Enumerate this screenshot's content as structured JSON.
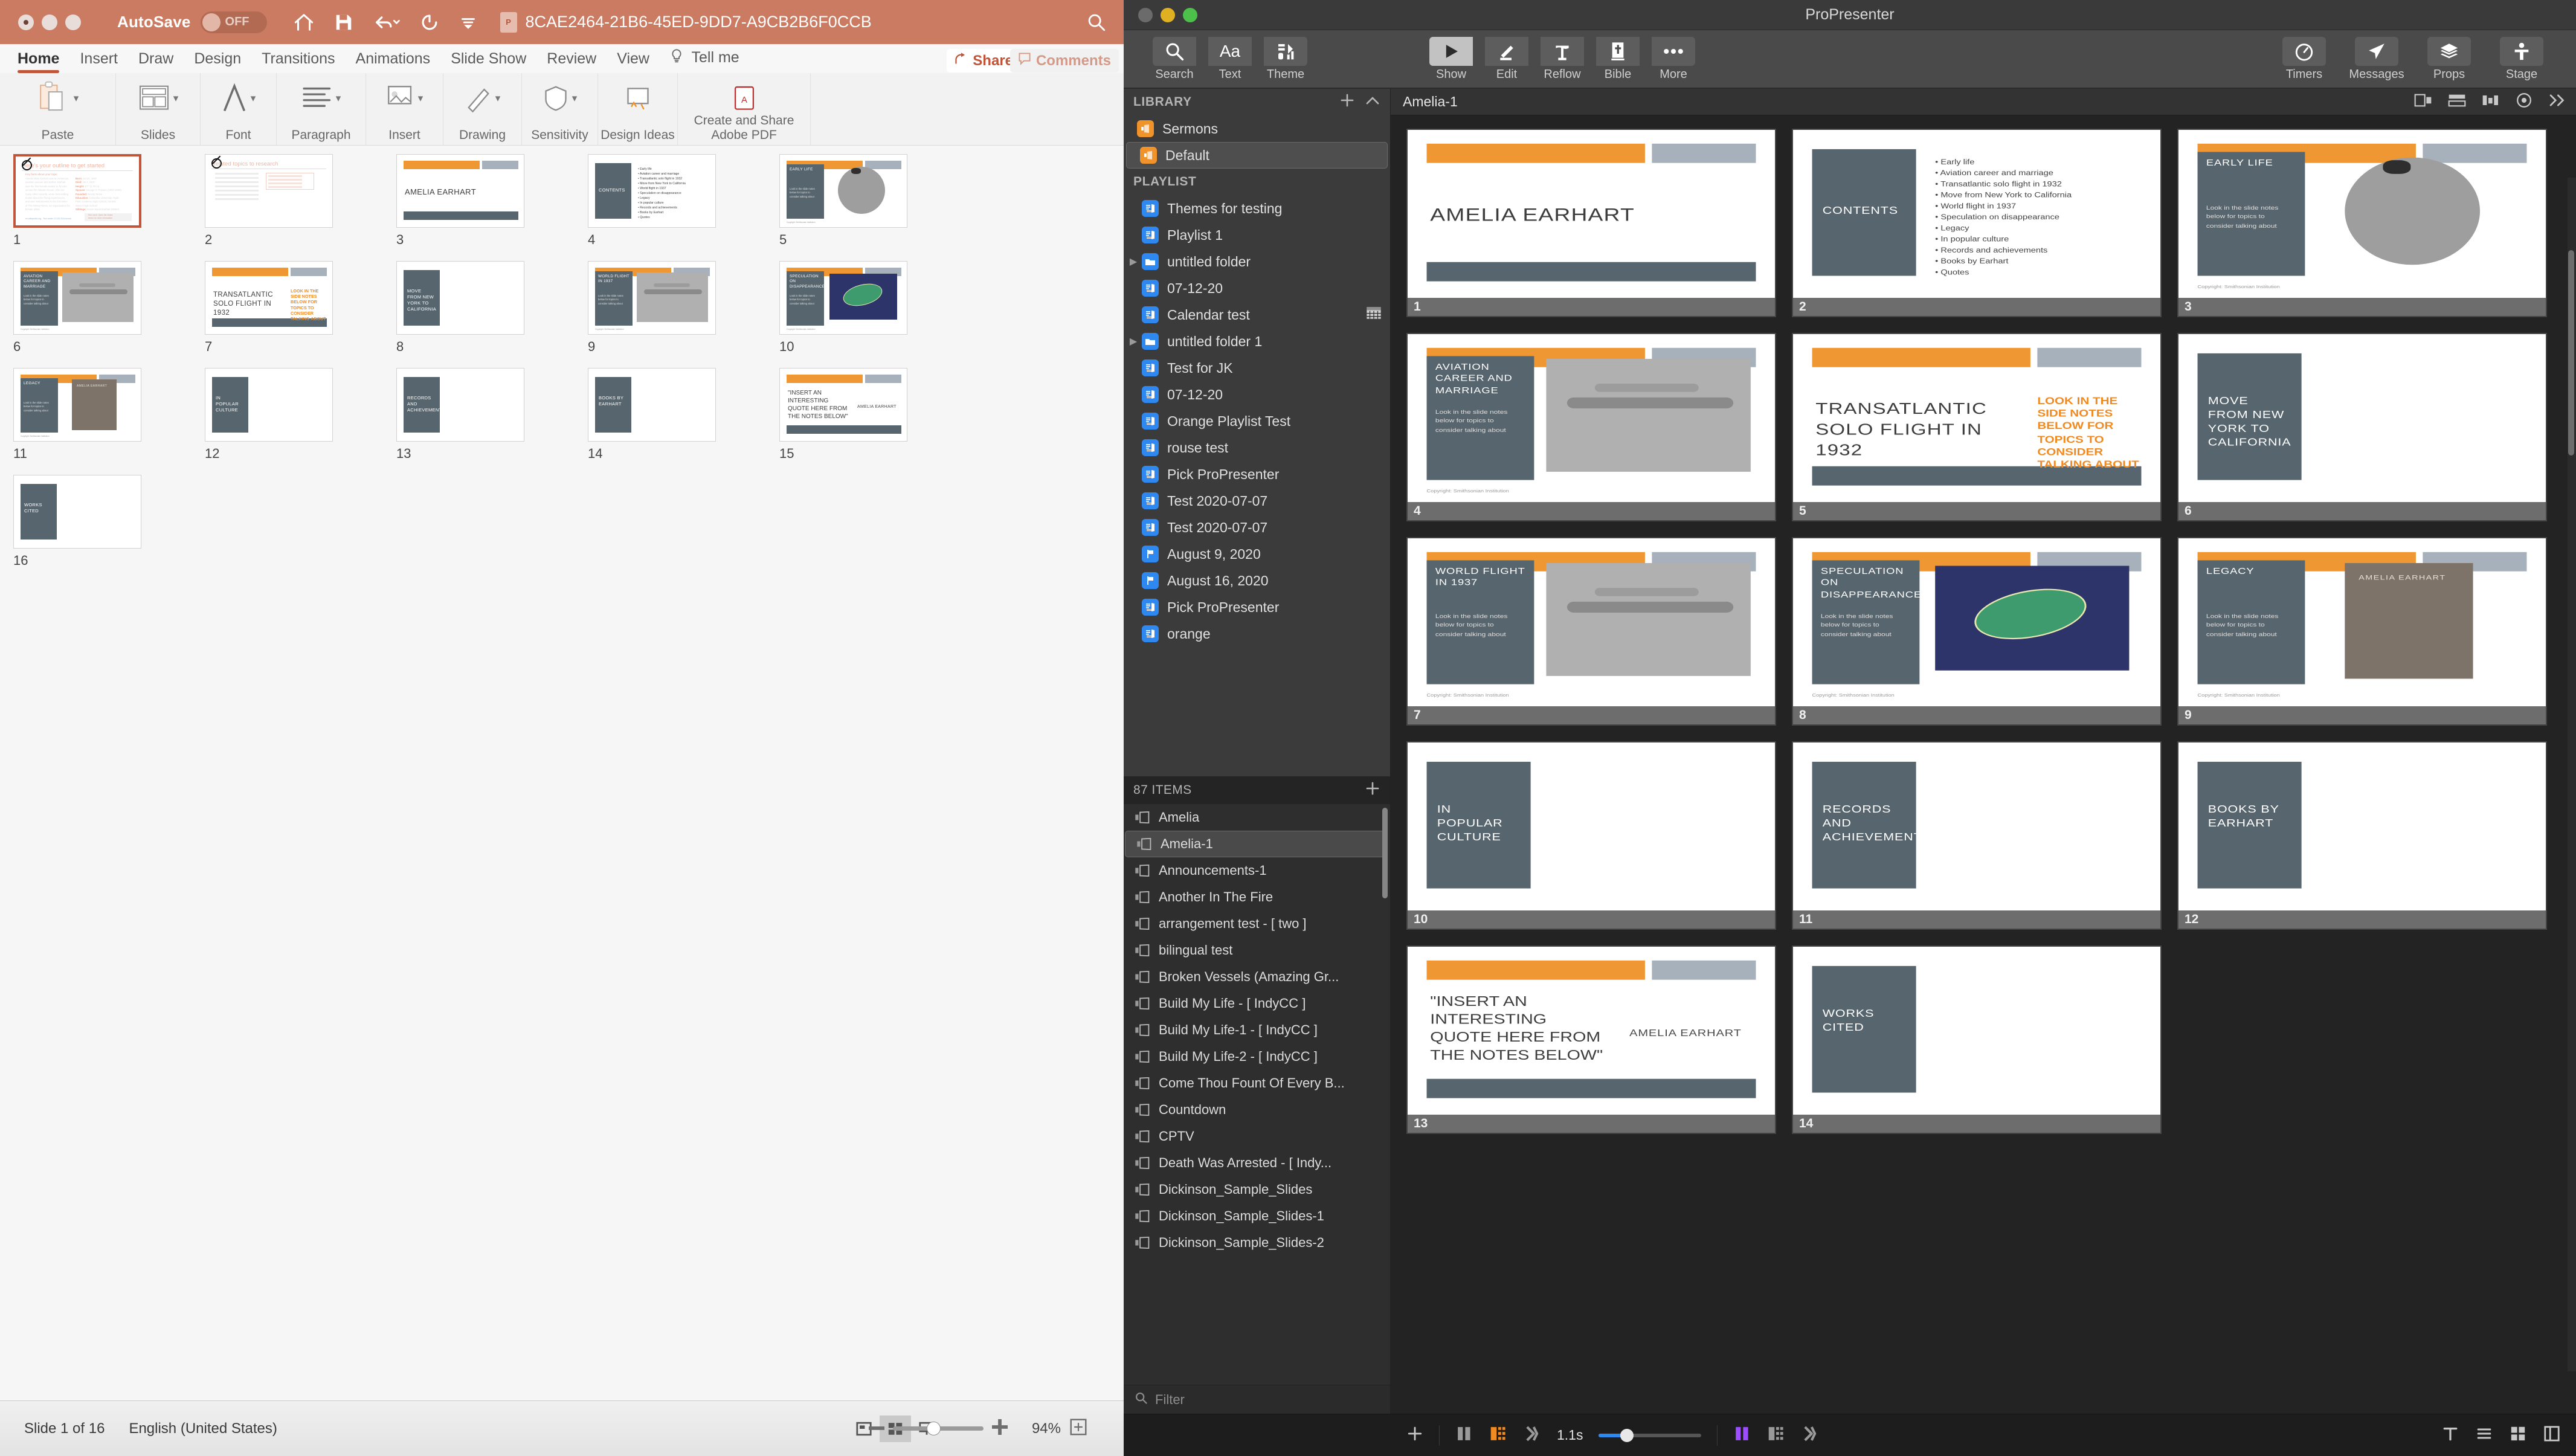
{
  "powerpoint": {
    "titlebar": {
      "autosave_label": "AutoSave",
      "autosave_state": "OFF",
      "filename": "8CAE2464-21B6-45ED-9DD7-A9CB2B6F0CCB",
      "quick_icons": [
        "home-icon",
        "save-icon",
        "undo-icon",
        "redo-icon",
        "customize-toolbar-icon"
      ],
      "search_icon": "search-icon"
    },
    "tabs": [
      {
        "label": "Home",
        "active": true
      },
      {
        "label": "Insert",
        "active": false
      },
      {
        "label": "Draw",
        "active": false
      },
      {
        "label": "Design",
        "active": false
      },
      {
        "label": "Transitions",
        "active": false
      },
      {
        "label": "Animations",
        "active": false
      },
      {
        "label": "Slide Show",
        "active": false
      },
      {
        "label": "Review",
        "active": false
      },
      {
        "label": "View",
        "active": false
      },
      {
        "label": "Tell me",
        "active": false
      }
    ],
    "share_label": "Share",
    "comments_label": "Comments",
    "ribbon_groups": [
      {
        "label": "Paste"
      },
      {
        "label": "Slides"
      },
      {
        "label": "Font"
      },
      {
        "label": "Paragraph"
      },
      {
        "label": "Insert"
      },
      {
        "label": "Drawing"
      },
      {
        "label": "Sensitivity"
      },
      {
        "label": "Design Ideas"
      },
      {
        "label": "Create and Share Adobe PDF"
      }
    ],
    "status": {
      "slide_counter": "Slide 1 of 16",
      "language": "English (United States)",
      "zoom_percent": "94%"
    },
    "slides": [
      {
        "num": "1",
        "type": "outline",
        "title": "Here's your outline to get started",
        "subtitle": "Key facts about your topic",
        "body": "Amelia Mary Earhart was an American aviation pioneer and author. Earhart was the first female aviator to fly solo across the Atlantic Ocean. She set many other records, wrote best-selling books about her flying experiences, and was instrumental in the formation of The Ninety-Nines, an organization for female pilots.",
        "facts": [
          "Born: Jul 24, 1897",
          "Died: Jul 2, 1937",
          "Height: 5'7\" (1.70 m)",
          "Spouse: George P. Putnam (1931-1939)",
          "Founded: Ninety-Nines",
          "Education: Columbia University, Hyde Park Academy High School, Central Senior High School",
          "Siblings: Grace Muriel Earhart (Sister)"
        ],
        "source": "en.wikipedia.org - Text under CC-BY-SA license",
        "seemore": "See more: Open the Notes below for more information."
      },
      {
        "num": "2",
        "type": "outline2",
        "title": "Related topics to research"
      },
      {
        "num": "3",
        "type": "title",
        "title": "AMELIA EARHART"
      },
      {
        "num": "4",
        "type": "contents",
        "label": "CONTENTS",
        "bullets": [
          "Early life",
          "Aviation career and marriage",
          "Transatlantic solo flight in 1932",
          "Move from New York to California",
          "World flight in 1937",
          "Speculation on disappearance",
          "Legacy",
          "In popular culture",
          "Records and achievements",
          "Books by Earhart",
          "Quotes"
        ]
      },
      {
        "num": "5",
        "type": "photo",
        "label": "EARLY LIFE",
        "note": "Look in the slide notes below for topics to consider talking about",
        "shape": "oval"
      },
      {
        "num": "6",
        "type": "photo",
        "label": "AVIATION CAREER AND MARRIAGE",
        "note": "Look in the slide notes below for topics to consider talking about",
        "shape": "rect"
      },
      {
        "num": "7",
        "type": "bigtitle",
        "title": "TRANSATLANTIC SOLO FLIGHT IN 1932",
        "orange_note": "LOOK IN THE SIDE NOTES BELOW FOR TOPICS TO CONSIDER TALKING ABOUT"
      },
      {
        "num": "8",
        "type": "boxonly",
        "label": "MOVE FROM NEW YORK TO CALIFORNIA"
      },
      {
        "num": "9",
        "type": "photo",
        "label": "WORLD FLIGHT IN 1937",
        "note": "Look in the slide notes below for topics to consider talking about",
        "shape": "rect"
      },
      {
        "num": "10",
        "type": "photo",
        "label": "SPECULATION ON DISAPPEARANCE",
        "note": "Look in the slide notes below for topics to consider talking about",
        "shape": "island"
      },
      {
        "num": "11",
        "type": "photo",
        "label": "LEGACY",
        "note": "Look in the slide notes below for topics to consider talking about",
        "shape": "plaque"
      },
      {
        "num": "12",
        "type": "boxonly",
        "label": "IN POPULAR CULTURE"
      },
      {
        "num": "13",
        "type": "boxonly",
        "label": "RECORDS AND ACHIEVEMENTS"
      },
      {
        "num": "14",
        "type": "boxonly",
        "label": "BOOKS BY EARHART"
      },
      {
        "num": "15",
        "type": "quote",
        "quote": "\"INSERT AN INTERESTING QUOTE HERE FROM THE NOTES BELOW\"",
        "attribution": "AMELIA EARHART"
      },
      {
        "num": "16",
        "type": "boxonly",
        "label": "WORKS CITED"
      }
    ]
  },
  "propresenter": {
    "app_name": "ProPresenter",
    "toolbar_left": [
      {
        "label": "Search",
        "icon": "search-icon",
        "active": false
      },
      {
        "label": "Text",
        "icon": "text-aa-icon",
        "active": false
      },
      {
        "label": "Theme",
        "icon": "theme-icon",
        "active": false
      }
    ],
    "toolbar_mid": [
      {
        "label": "Show",
        "icon": "play-icon",
        "active": true
      },
      {
        "label": "Edit",
        "icon": "pencil-icon",
        "active": false
      },
      {
        "label": "Reflow",
        "icon": "reflow-icon",
        "active": false
      },
      {
        "label": "Bible",
        "icon": "bible-icon",
        "active": false
      },
      {
        "label": "More",
        "icon": "ellipsis-icon",
        "active": false
      }
    ],
    "toolbar_right": [
      {
        "label": "Timers",
        "icon": "timer-icon"
      },
      {
        "label": "Messages",
        "icon": "paper-plane-icon"
      },
      {
        "label": "Props",
        "icon": "layers-icon"
      },
      {
        "label": "Stage",
        "icon": "stage-icon"
      }
    ],
    "library": {
      "header": "LIBRARY",
      "add_icon": "plus-icon",
      "collapse_icon": "chevron-up-icon",
      "items": [
        {
          "label": "Sermons",
          "icon": "library-icon",
          "selected": false
        },
        {
          "label": "Default",
          "icon": "library-icon",
          "selected": true
        }
      ]
    },
    "playlist": {
      "header": "PLAYLIST",
      "items": [
        {
          "label": "Themes for testing",
          "icon": "playlist-icon",
          "expandable": false
        },
        {
          "label": "Playlist 1",
          "icon": "playlist-icon",
          "expandable": false
        },
        {
          "label": "untitled folder",
          "icon": "folder-icon",
          "expandable": true
        },
        {
          "label": "07-12-20",
          "icon": "playlist-icon",
          "expandable": false
        },
        {
          "label": "Calendar test",
          "icon": "playlist-icon",
          "expandable": false,
          "badge": "calendar-icon"
        },
        {
          "label": "untitled folder 1",
          "icon": "folder-icon",
          "expandable": true
        },
        {
          "label": "Test for JK",
          "icon": "playlist-icon",
          "expandable": false
        },
        {
          "label": "07-12-20",
          "icon": "playlist-icon",
          "expandable": false
        },
        {
          "label": "Orange Playlist Test",
          "icon": "playlist-icon",
          "expandable": false
        },
        {
          "label": "rouse test",
          "icon": "playlist-icon",
          "expandable": false
        },
        {
          "label": "Pick ProPresenter",
          "icon": "playlist-icon",
          "expandable": false
        },
        {
          "label": "Test 2020-07-07",
          "icon": "playlist-icon",
          "expandable": false
        },
        {
          "label": "Test 2020-07-07",
          "icon": "playlist-icon",
          "expandable": false
        },
        {
          "label": "August 9, 2020",
          "icon": "flag-icon",
          "expandable": false
        },
        {
          "label": "August 16, 2020",
          "icon": "flag-icon",
          "expandable": false
        },
        {
          "label": "Pick ProPresenter",
          "icon": "playlist-icon",
          "expandable": false
        },
        {
          "label": "orange",
          "icon": "playlist-icon",
          "expandable": false
        }
      ]
    },
    "items_panel": {
      "header": "87 ITEMS",
      "add_icon": "plus-icon",
      "items": [
        {
          "label": "Amelia",
          "selected": false
        },
        {
          "label": "Amelia-1",
          "selected": true
        },
        {
          "label": "Announcements-1",
          "selected": false
        },
        {
          "label": "Another In The Fire",
          "selected": false
        },
        {
          "label": "arrangement test - [ two ]",
          "selected": false
        },
        {
          "label": "bilingual test",
          "selected": false
        },
        {
          "label": "Broken Vessels (Amazing Gr...",
          "selected": false
        },
        {
          "label": "Build My Life - [ IndyCC ]",
          "selected": false
        },
        {
          "label": "Build My Life-1 - [ IndyCC ]",
          "selected": false
        },
        {
          "label": "Build My Life-2 - [ IndyCC ]",
          "selected": false
        },
        {
          "label": "Come Thou Fount Of Every B...",
          "selected": false
        },
        {
          "label": "Countdown",
          "selected": false
        },
        {
          "label": "CPTV",
          "selected": false
        },
        {
          "label": "Death Was Arrested - [ Indy...",
          "selected": false
        },
        {
          "label": "Dickinson_Sample_Slides",
          "selected": false
        },
        {
          "label": "Dickinson_Sample_Slides-1",
          "selected": false
        },
        {
          "label": "Dickinson_Sample_Slides-2",
          "selected": false
        }
      ],
      "filter_placeholder": "Filter",
      "filter_icon": "search-icon"
    },
    "document": {
      "title": "Amelia-1",
      "tool_icons": [
        "arrangement-icon",
        "group-icon",
        "align-icon",
        "record-icon",
        "expand-icon"
      ]
    },
    "bottom_bar": {
      "add_icon": "plus-icon",
      "transition_time": "1.1s",
      "transition_icons": [
        "pause-icon",
        "transition-icon",
        "advance-icon"
      ],
      "right_icons": [
        "pause-purple-icon",
        "transition-gray-icon",
        "advance-gray-icon"
      ],
      "status_icons": [
        "type-icon",
        "list-icon",
        "grid-icon",
        "layout-icon"
      ]
    },
    "slides": [
      {
        "num": "1",
        "type": "title",
        "title": "AMELIA EARHART"
      },
      {
        "num": "2",
        "type": "contents",
        "label": "CONTENTS",
        "bullets": [
          "Early life",
          "Aviation career and marriage",
          "Transatlantic solo flight in 1932",
          "Move from New York to California",
          "World flight in 1937",
          "Speculation on disappearance",
          "Legacy",
          "In popular culture",
          "Records and achievements",
          "Books by Earhart",
          "Quotes"
        ]
      },
      {
        "num": "3",
        "type": "photo",
        "label": "EARLY LIFE",
        "note": "Look in the slide notes below for topics to consider talking about",
        "shape": "oval"
      },
      {
        "num": "4",
        "type": "photo",
        "label": "AVIATION CAREER AND MARRIAGE",
        "note": "Look in the slide notes below for topics to consider talking about",
        "shape": "rect"
      },
      {
        "num": "5",
        "type": "bigtitle",
        "title": "TRANSATLANTIC SOLO FLIGHT IN 1932",
        "orange_note": "LOOK IN THE SIDE NOTES BELOW FOR TOPICS TO CONSIDER TALKING ABOUT"
      },
      {
        "num": "6",
        "type": "boxonly",
        "label": "MOVE FROM NEW YORK TO CALIFORNIA"
      },
      {
        "num": "7",
        "type": "photo",
        "label": "WORLD FLIGHT IN 1937",
        "note": "Look in the slide notes below for topics to consider talking about",
        "shape": "rect"
      },
      {
        "num": "8",
        "type": "photo",
        "label": "SPECULATION ON DISAPPEARANCE",
        "note": "Look in the slide notes below for topics to consider talking about",
        "shape": "island"
      },
      {
        "num": "9",
        "type": "photo",
        "label": "LEGACY",
        "note": "Look in the slide notes below for topics to consider talking about",
        "shape": "plaque"
      },
      {
        "num": "10",
        "type": "boxonly",
        "label": "IN POPULAR CULTURE"
      },
      {
        "num": "11",
        "type": "boxonly",
        "label": "RECORDS AND ACHIEVEMENTS"
      },
      {
        "num": "12",
        "type": "boxonly",
        "label": "BOOKS BY EARHART"
      },
      {
        "num": "13",
        "type": "quote",
        "quote": "\"INSERT AN INTERESTING QUOTE HERE FROM THE NOTES BELOW\"",
        "attribution": "AMELIA EARHART"
      },
      {
        "num": "14",
        "type": "boxonly",
        "label": "WORKS CITED"
      }
    ]
  },
  "colors": {
    "ppt_accent": "#cb7b61",
    "ppt_tab_underline": "#c0553a",
    "slide_orange": "#ef9733",
    "slide_gray": "#a7b1bb",
    "slide_slate": "#56656e",
    "pp_bg": "#2b2b2b",
    "pp_toolbar": "#4a4a4a",
    "pp_blue": "#2f87f0",
    "pp_library_orange": "#f0932b",
    "pp_purple": "#9b4dff"
  }
}
